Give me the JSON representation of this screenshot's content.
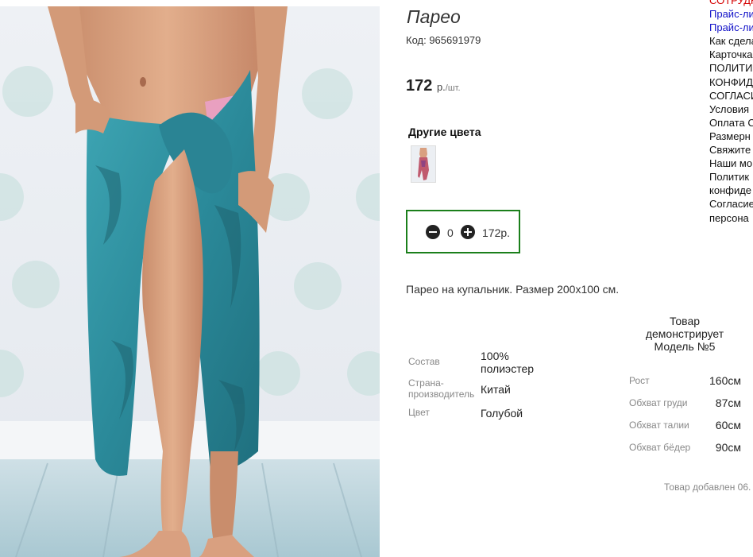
{
  "product": {
    "title": "Парео",
    "code": "Код: 965691979",
    "price_value": "172",
    "price_currency": "р.",
    "price_unit": "/шт.",
    "other_colors_title": "Другие цвета",
    "description": "Парео на купальник. Размер 200х100 см."
  },
  "cart": {
    "quantity": "0",
    "total": "172р."
  },
  "specs": [
    {
      "label": "Состав",
      "value": "100% полиэстер"
    },
    {
      "label": "Страна-производитель",
      "value": "Китай"
    },
    {
      "label": "Цвет",
      "value": "Голубой"
    }
  ],
  "model": {
    "caption": "Товар демонстрирует Модель №5",
    "params": [
      {
        "label": "Рост",
        "value": "160см"
      },
      {
        "label": "Обхват груди",
        "value": "87см"
      },
      {
        "label": "Обхват талии",
        "value": "60см"
      },
      {
        "label": "Обхват бёдер",
        "value": "90см"
      }
    ]
  },
  "added_text": "Товар добавлен 06.",
  "side_links": [
    "СОТРУДН",
    "Прайс-ли",
    "Прайс-ли",
    "Как сдела",
    "Карточка",
    "ПОЛИТИК",
    "КОНФИДЕ",
    "СОГЛАСИ",
    "Условия",
    "Оплата С",
    "Размерн",
    "Свяжите",
    "Наши мо",
    "Политик",
    "конфиде",
    "Согласие",
    "персона"
  ],
  "colors": {
    "accent_border": "#1b7f1b",
    "link_red": "#d40000",
    "link_blue": "#1010c8",
    "pareo_teal": "#2e93a3"
  },
  "icons": [
    "minus-circle-icon",
    "plus-circle-icon"
  ]
}
